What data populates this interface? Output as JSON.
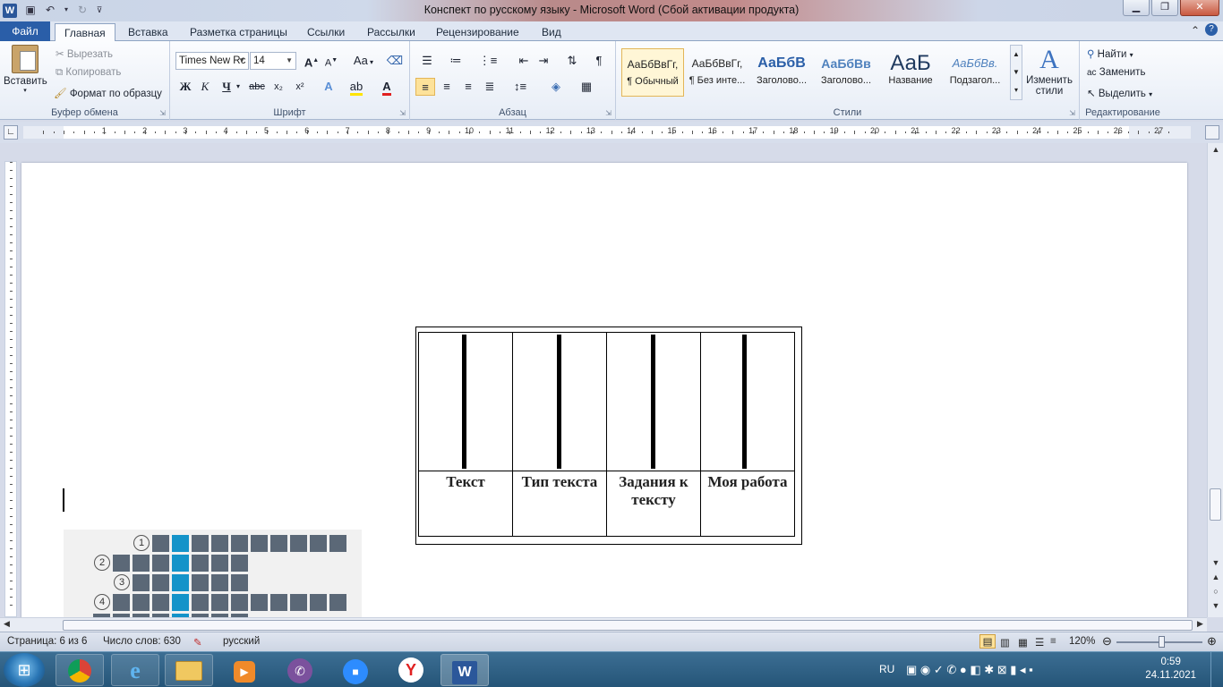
{
  "window": {
    "title": "Конспект по русскому языку  -  Microsoft Word (Сбой активации продукта)",
    "app_icon_letter": "W"
  },
  "ribbon": {
    "tabs": [
      "Файл",
      "Главная",
      "Вставка",
      "Разметка страницы",
      "Ссылки",
      "Рассылки",
      "Рецензирование",
      "Вид"
    ],
    "active_tab": "Главная",
    "clipboard": {
      "label": "Буфер обмена",
      "paste": "Вставить",
      "cut": "Вырезать",
      "copy": "Копировать",
      "format_painter": "Формат по образцу"
    },
    "font": {
      "label": "Шрифт",
      "font_name": "Times New Rc",
      "font_size": "14",
      "case": "Aa",
      "grow": "A",
      "shrink": "A",
      "bold": "Ж",
      "italic": "К",
      "underline": "Ч",
      "strike": "abc",
      "subscript": "x₂",
      "superscript": "x²"
    },
    "paragraph": {
      "label": "Абзац"
    },
    "styles": {
      "label": "Стили",
      "items": [
        {
          "sample": "АаБбВвГг,",
          "name": "¶ Обычный"
        },
        {
          "sample": "АаБбВвГг,",
          "name": "¶ Без инте..."
        },
        {
          "sample": "АаБбВ",
          "name": "Заголово..."
        },
        {
          "sample": "АаБбВв",
          "name": "Заголово..."
        },
        {
          "sample": "АаБ",
          "name": "Название"
        },
        {
          "sample": "АаБбВв.",
          "name": "Подзагол..."
        }
      ],
      "change_styles": "Изменить стили"
    },
    "editing": {
      "label": "Редактирование",
      "find": "Найти",
      "replace": "Заменить",
      "select": "Выделить"
    }
  },
  "ruler": {
    "numbers": [
      "1",
      "2",
      "3",
      "4",
      "5",
      "6",
      "7",
      "8",
      "9",
      "10",
      "11",
      "12",
      "13",
      "14",
      "15",
      "16",
      "17",
      "18",
      "19",
      "20",
      "21",
      "22",
      "23",
      "24",
      "25",
      "26",
      "27"
    ]
  },
  "document": {
    "table_headers": [
      "Текст",
      "Тип текста",
      "Задания к тексту",
      "Моя работа"
    ],
    "crossword_numbers": [
      "1",
      "2",
      "3",
      "4"
    ]
  },
  "statusbar": {
    "page": "Страница: 6 из 6",
    "words": "Число слов: 630",
    "language": "русский",
    "zoom": "120%"
  },
  "taskbar": {
    "lang": "RU",
    "time": "0:59",
    "date": "24.11.2021"
  }
}
